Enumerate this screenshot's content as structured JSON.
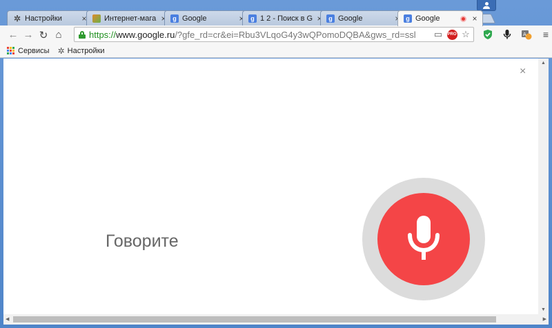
{
  "tabs": [
    {
      "title": "Настройки",
      "favicon": "gear-icon"
    },
    {
      "title": "Интернет-мага",
      "favicon": "shop-icon"
    },
    {
      "title": "Google",
      "favicon": "google-icon"
    },
    {
      "title": "1 2 - Поиск в G",
      "favicon": "google-icon"
    },
    {
      "title": "Google",
      "favicon": "google-icon"
    },
    {
      "title": "Google",
      "favicon": "google-icon",
      "active": true,
      "recording": true
    }
  ],
  "toolbar": {
    "url_scheme": "https://",
    "url_host": "www.google.ru",
    "url_path": "/?gfe_rd=cr&ei=Rbu3VLqoG4y3wQPomoDQBA&gws_rd=ssl",
    "pro_badge": "PRO"
  },
  "bookmarks": {
    "apps_label": "Сервисы",
    "settings_label": "Настройки"
  },
  "voice": {
    "prompt": "Говорите"
  },
  "colors": {
    "mic_red": "#f44547",
    "ring_gray": "#dcdcdc",
    "secure_green": "#1f8f1f"
  }
}
